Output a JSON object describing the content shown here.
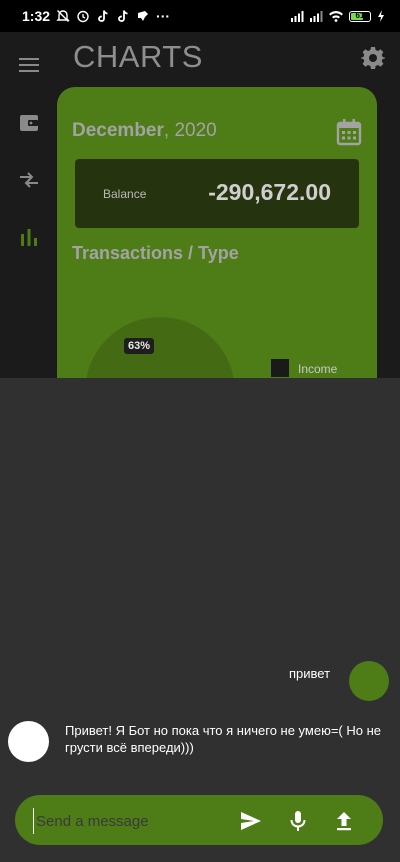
{
  "status_bar": {
    "time": "1:32",
    "ellipsis": "···",
    "battery": "61",
    "left_icons": [
      "mute-icon",
      "alarm-icon",
      "tiktok-icon",
      "tiktok-icon",
      "app-icon"
    ],
    "right_icons": [
      "signal-icon",
      "signal-icon",
      "wifi-icon",
      "battery-icon",
      "charging-icon"
    ]
  },
  "app": {
    "title": "CHARTS",
    "rail_icons": [
      "menu-icon",
      "wallet-icon",
      "transfer-icon",
      "chart-icon"
    ],
    "settings_icon": "gear-icon"
  },
  "card": {
    "month": "December",
    "year_part": ", 2020",
    "calendar_icon": "calendar-icon",
    "balance_label": "Balance",
    "balance_value": "-290,672.00",
    "section_title": "Transactions / Type"
  },
  "chart_data": {
    "type": "pie",
    "slice_label": "63%",
    "legend": [
      "Income"
    ]
  },
  "chat": {
    "messages": [
      {
        "sender": "user",
        "text": "привет"
      },
      {
        "sender": "bot",
        "text": "Привет! Я Бот но пока что я ничего не умею=( Но не грусти всё впереди)))"
      }
    ],
    "input_placeholder": "Send a message",
    "buttons": [
      "send-icon",
      "mic-icon",
      "upload-icon"
    ]
  },
  "colors": {
    "accent": "#4e7c17",
    "sheet": "#303030",
    "background": "#1b1b1b"
  }
}
